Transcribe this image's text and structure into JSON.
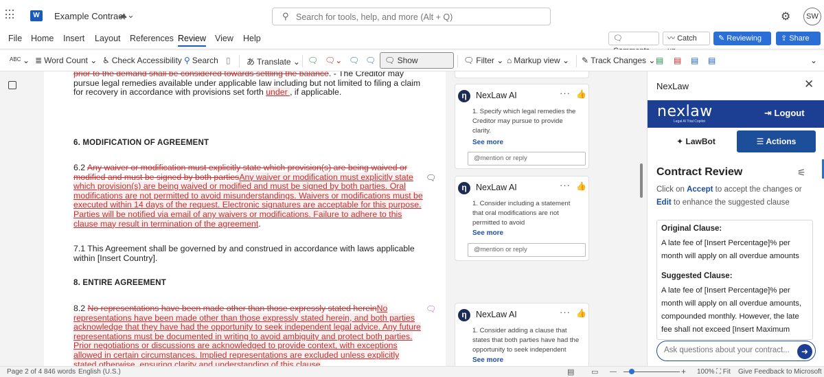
{
  "titlebar": {
    "app_icon": "word-icon",
    "doc_title": "Example Contract",
    "search_placeholder": "Search for tools, help, and more (Alt + Q)",
    "user_initials": "SW"
  },
  "menu": {
    "tabs": [
      "File",
      "Home",
      "Insert",
      "Layout",
      "References",
      "Review",
      "View",
      "Help"
    ],
    "active_tab": "Review",
    "comments_btn": "Comments",
    "catchup_btn": "Catch up",
    "reviewing_btn": "Reviewing",
    "share_btn": "Share"
  },
  "ribbon": {
    "abc_icon": "ABC",
    "word_count": "Word Count",
    "check_accessibility": "Check Accessibility",
    "search": "Search",
    "translate": "Translate",
    "show_comments": "Show Comments",
    "filter": "Filter",
    "markup_view": "Markup view",
    "track_changes": "Track Changes"
  },
  "document": {
    "p_top_del": "prior to the demand shall be considered towards settling the balance",
    "p_top_rest1": ". - The Creditor may pursue legal remedies available under applicable law including but not limited to filing a claim for recovery in accordance with provisions set forth ",
    "p_top_ins": "under ",
    "p_top_rest2": ", if applicable.",
    "h6": "6. MODIFICATION OF AGREEMENT",
    "p62_num": "6.2 ",
    "p62_del": "Any waiver or modification must explicitly state which provision(s) are being waived or modified and must be signed by both parties",
    "p62_ins": "Any waiver or modification must explicitly state which provision(s) are being waived or modified and must be signed by both parties. Oral modifications are not permitted to avoid misunderstandings. Waivers or modifications must be executed within 14 days of the request. Electronic signatures are acceptable for this purpose. Parties will be notified via email of any waivers or modifications. Failure to adhere to this clause may result in termination of the agreement",
    "p62_end": ".",
    "p71": "7.1 This Agreement shall be governed by and construed in accordance with laws applicable within [Insert Country].",
    "h8": "8. ENTIRE AGREEMENT",
    "p82_num": "8.2 ",
    "p82_del": "No representations have been made other than those expressly stated herein",
    "p82_ins": "No representations have been made other than those expressly stated herein, and both parties acknowledge that they have had the opportunity to seek independent legal advice. Any future representations must be documented in writing to avoid ambiguity and protect both parties. Prior negotiations or discussions are acknowledged to provide context, with exceptions allowed in certain circumstances. Implied representations are excluded unless explicitly stated otherwise, ensuring clarity and understanding of this clause"
  },
  "comments": [
    {
      "author": "NexLaw AI",
      "body": "1. Specify which legal remedies the Creditor may pursue to provide clarity.",
      "see_more": "See more",
      "reply_placeholder": "@mention or reply"
    },
    {
      "author": "NexLaw AI",
      "body": "1. Consider including a statement that oral modifications are not permitted to avoid",
      "see_more": "See more",
      "reply_placeholder": "@mention or reply"
    },
    {
      "author": "NexLaw AI",
      "body": "1. Consider adding a clause that states that both parties have had the opportunity to seek independent",
      "see_more": "See more"
    }
  ],
  "panel": {
    "title": "NexLaw",
    "logo": "nexlaw",
    "logo_tagline": "Legal AI Trial Copilot",
    "logout": "Logout",
    "tab_lawbot": "LawBot",
    "tab_actions": "Actions",
    "cr_title": "Contract Review",
    "cr_click": "Click on ",
    "cr_accept": "Accept",
    "cr_mid": " to accept the changes or ",
    "cr_edit": "Edit",
    "cr_tail": " to enhance the suggested clause",
    "original_label": "Original Clause:",
    "original_text": "A late fee of [Insert Percentage]% per month will apply on all overdue amounts",
    "suggested_label": "Suggested Clause:",
    "suggested_text": "A late fee of [Insert Percentage]% per month will apply on all overdue amounts, compounded monthly. However, the late fee shall not exceed [Insert Maximum Amount]",
    "ask_placeholder": "Ask questions about your contract...",
    "accent_color": "#1c3f94"
  },
  "statusbar": {
    "page": "Page 2 of 4",
    "words": "846 words",
    "language": "English (U.S.)",
    "zoom_level": "100%",
    "zoom_fraction": 0.15,
    "fit": "Fit",
    "feedback": "Give Feedback to Microsoft"
  }
}
